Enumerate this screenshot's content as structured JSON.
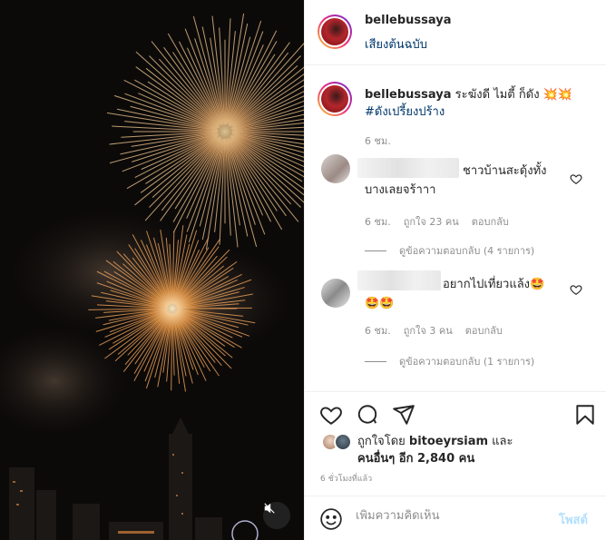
{
  "post": {
    "username": "bellebussaya",
    "audio_label": "เสียงต้นฉบับ",
    "caption_text": "ระฆังดี ไมตี้ ก็ดัง 💥💥",
    "caption_hashtag": "#ดังเปรี้ยงปร้าง",
    "caption_time": "6 ชม."
  },
  "comments": [
    {
      "text": "ชาวบ้านสะดุ้งทั้งบางเลยจร้าาา",
      "time": "6 ชม.",
      "likes": "ถูกใจ 23 คน",
      "reply_label": "ตอบกลับ",
      "view_replies": "ดูข้อความตอบกลับ (4 รายการ)"
    },
    {
      "text": "อยากไปเที่ยวแล้ง🤩🤩🤩",
      "time": "6 ชม.",
      "likes": "ถูกใจ 3 คน",
      "reply_label": "ตอบกลับ",
      "view_replies": "ดูข้อความตอบกลับ (1 รายการ)"
    }
  ],
  "likes": {
    "prefix": "ถูกใจโดย",
    "liker": "bitoeyrsiam",
    "connector": "และ",
    "others_label": "คนอื่นๆ อีก 2,840 คน"
  },
  "post_time": "6 ชั่วโมงที่แล้ว",
  "comment_input": {
    "placeholder": "เพิ่มความคิดเห็น",
    "submit_label": "โพสต์"
  },
  "colors": {
    "link": "#00376b",
    "muted": "#8e8e8e",
    "post_disabled": "#b2dffc"
  },
  "icons": [
    "heart-icon",
    "comment-icon",
    "share-icon",
    "bookmark-icon",
    "emoji-icon",
    "mute-icon"
  ]
}
